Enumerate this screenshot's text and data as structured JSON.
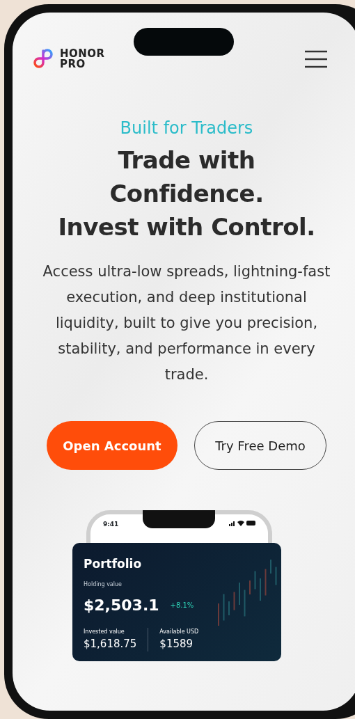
{
  "header": {
    "logo_lines": [
      "HONOR",
      "PRO"
    ]
  },
  "hero": {
    "tagline": "Built for Traders",
    "headline_lines": [
      "Trade with",
      "Confidence.",
      "Invest with Control."
    ],
    "description": "Access ultra-low spreads, lightning-fast execution, and deep institutional liquidity, built to give you precision, stability, and performance in every trade.",
    "buttons": [
      {
        "label": "Open Account",
        "kind": "primary"
      },
      {
        "label": "Try Free Demo",
        "kind": "outline"
      }
    ]
  },
  "preview": {
    "status_time": "9:41",
    "card": {
      "title": "Portfolio",
      "holding_label": "Holding value",
      "holding_value": "$2,503.1",
      "change": "+8.1%",
      "stats": [
        {
          "label": "Invested value",
          "value": "$1,618.75"
        },
        {
          "label": "Available USD",
          "value": "$1589"
        }
      ]
    }
  }
}
